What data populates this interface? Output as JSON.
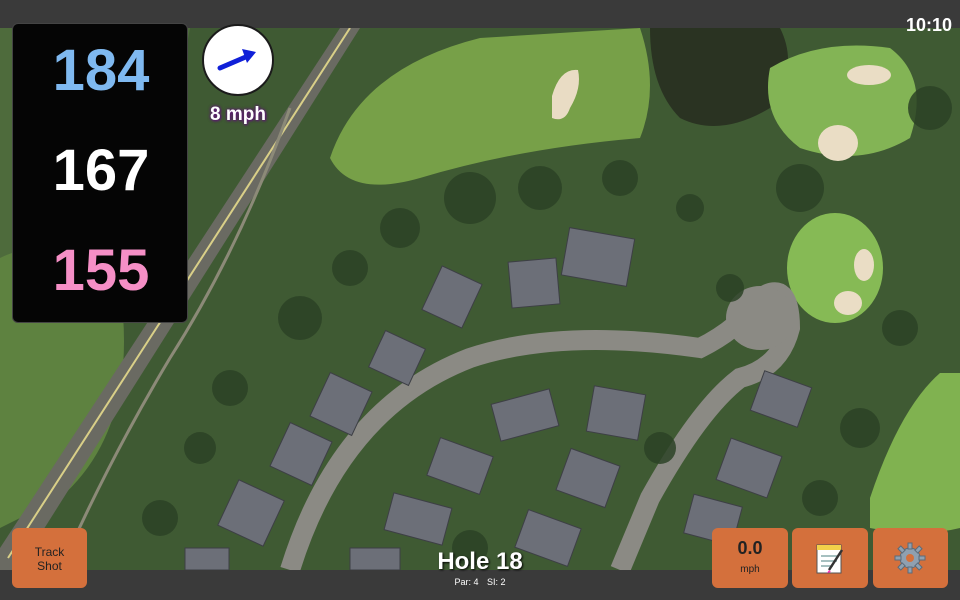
{
  "status": {
    "time": "10:10"
  },
  "distances": {
    "back": "184",
    "center": "167",
    "front": "155"
  },
  "wind": {
    "speed_label": "8 mph",
    "direction_icon": "wind-arrow-icon"
  },
  "buttons": {
    "track_shot_line1": "Track",
    "track_shot_line2": "Shot",
    "speed_value": "0.0",
    "speed_unit": "mph",
    "notes_icon": "notepad-icon",
    "settings_icon": "gear-icon"
  },
  "hole": {
    "title": "Hole 18",
    "par": "Par: 4",
    "si": "SI: 2"
  },
  "colors": {
    "back_distance": "#7fb9f0",
    "center_distance": "#ffffff",
    "front_distance": "#f58fc6",
    "button": "#d4703c",
    "wind_arrow": "#1020d8"
  }
}
